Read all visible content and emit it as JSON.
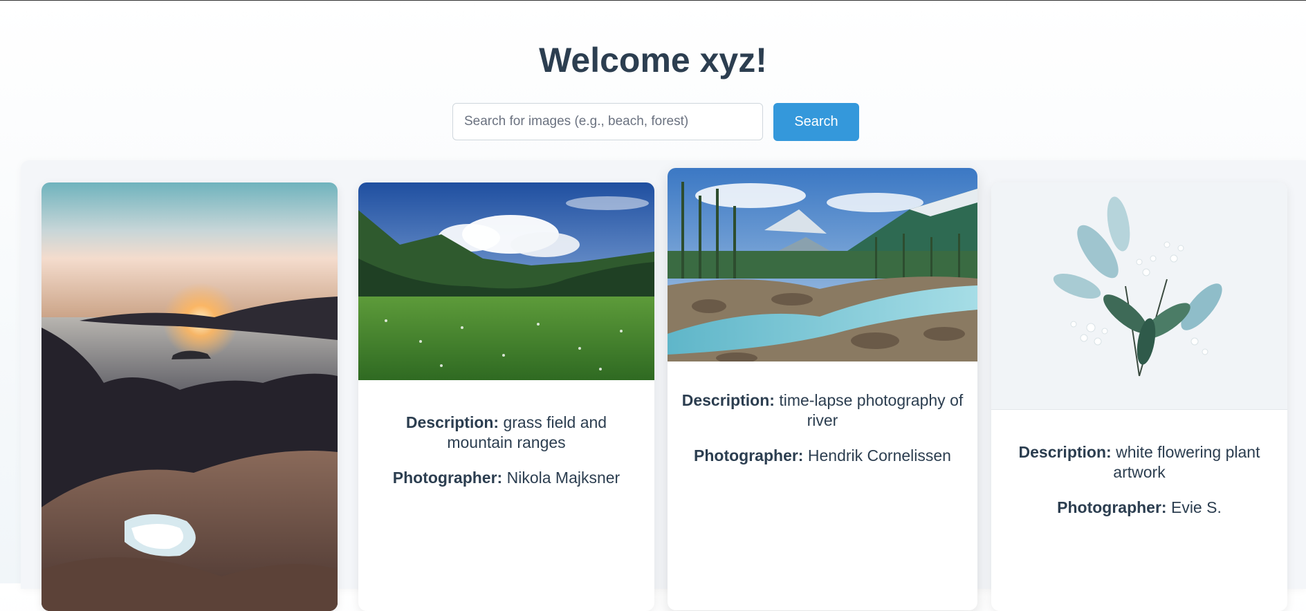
{
  "header": {
    "title": "Welcome xyz!"
  },
  "search": {
    "placeholder": "Search for images (e.g., beach, forest)",
    "value": "",
    "button_label": "Search"
  },
  "colors": {
    "accent": "#3498db",
    "text": "#2c3e50"
  },
  "cards": [
    {
      "description_label": "",
      "description": "",
      "photographer_label": "",
      "photographer": ""
    },
    {
      "description_label": "Description:",
      "description": "grass field and mountain ranges",
      "photographer_label": "Photographer:",
      "photographer": "Nikola Majksner"
    },
    {
      "description_label": "Description:",
      "description": "time-lapse photography of river",
      "photographer_label": "Photographer:",
      "photographer": "Hendrik Cornelissen"
    },
    {
      "description_label": "Description:",
      "description": "white flowering plant artwork",
      "photographer_label": "Photographer:",
      "photographer": "Evie S."
    }
  ]
}
